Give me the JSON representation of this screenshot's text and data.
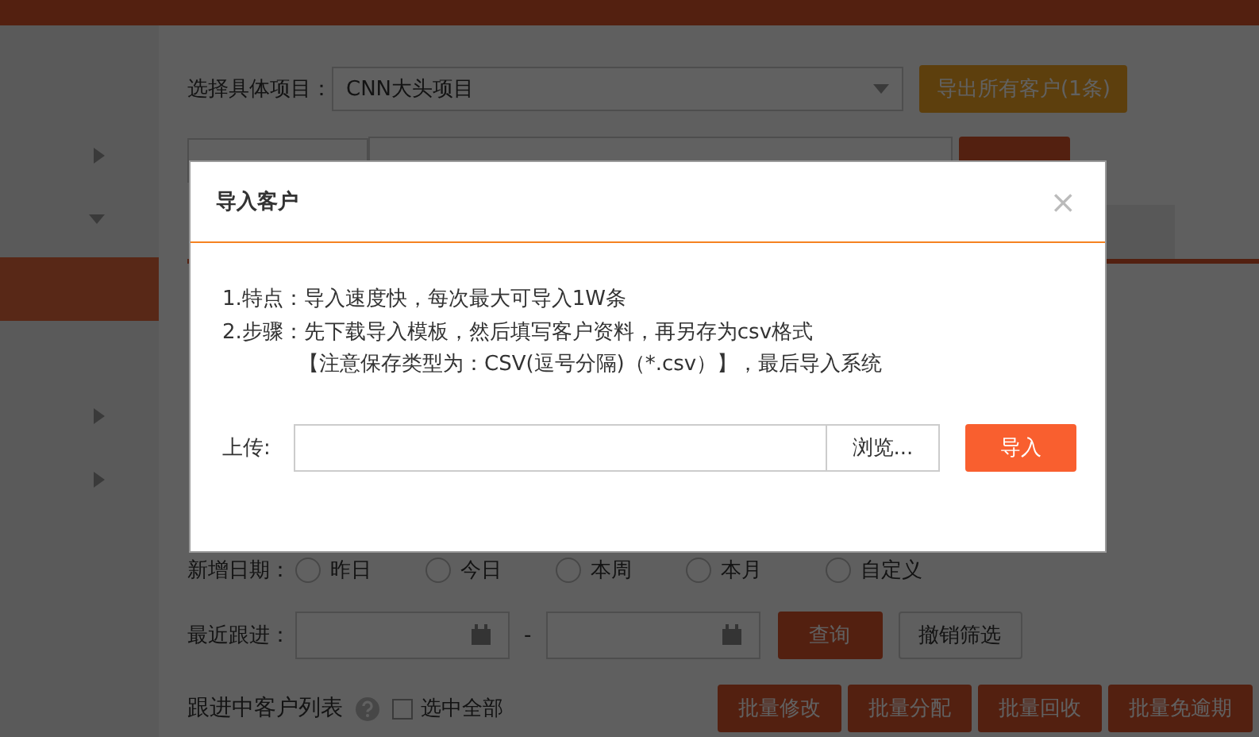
{
  "sidebar": {
    "items": [
      {
        "kind": "expandable",
        "selected": false
      },
      {
        "kind": "expanded",
        "selected": false
      },
      {
        "kind": "plain",
        "selected": true
      },
      {
        "kind": "plain",
        "selected": false
      },
      {
        "kind": "expandable",
        "selected": false
      },
      {
        "kind": "expandable",
        "selected": false
      }
    ]
  },
  "project": {
    "label": "选择具体项目：",
    "value": "CNN大头项目",
    "export_button": "导出所有客户(1条)"
  },
  "new_date": {
    "label": "新增日期：",
    "options": [
      {
        "label": "昨日",
        "selected": false
      },
      {
        "label": "今日",
        "selected": false
      },
      {
        "label": "本周",
        "selected": false
      },
      {
        "label": "本月",
        "selected": false
      },
      {
        "label": "自定义",
        "selected": false
      }
    ]
  },
  "follow": {
    "label": "最近跟进：",
    "separator": "-",
    "query_button": "查询",
    "reset_button": "撤销筛选"
  },
  "list": {
    "title": "跟进中客户列表",
    "select_all": {
      "label": "选中全部",
      "checked": false
    },
    "buttons": [
      "批量修改",
      "批量分配",
      "批量回收",
      "批量免逾期"
    ]
  },
  "dialog": {
    "title": "导入客户",
    "close": "×",
    "lines": [
      "1.特点：导入速度快，每次最大可导入1W条",
      "2.步骤：先下载导入模板，然后填写客户资料，再另存为csv格式",
      "【注意保存类型为：CSV(逗号分隔)（*.csv）】，最后导入系统"
    ],
    "upload_label": "上传:",
    "browse_button": "浏览...",
    "import_button": "导入"
  }
}
